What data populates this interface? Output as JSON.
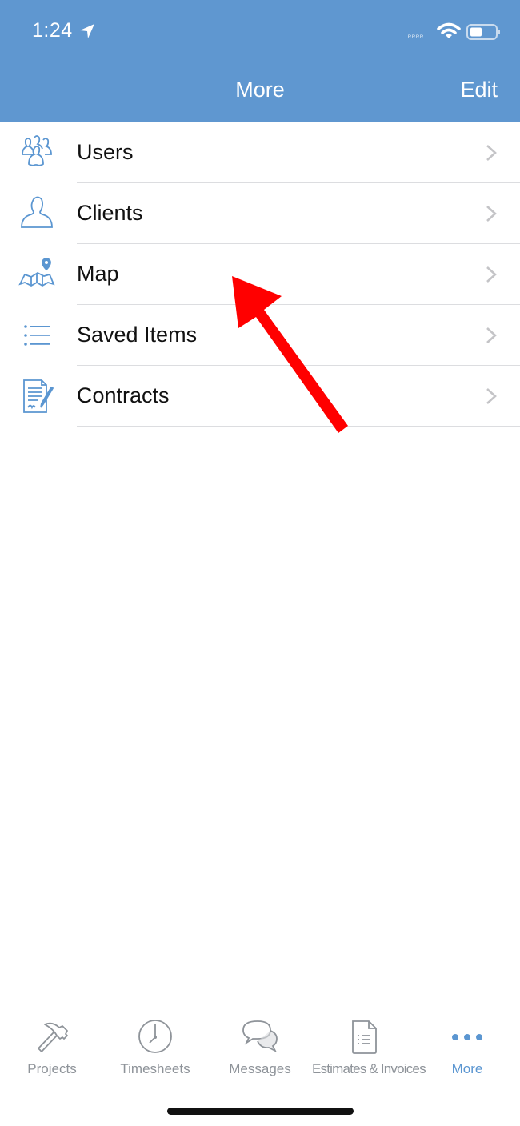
{
  "status_bar": {
    "time": "1:24",
    "signal_text": "ᴿᴿᴿᴿ",
    "icons": [
      "location-arrow-icon",
      "wifi-icon",
      "battery-icon"
    ]
  },
  "nav": {
    "title": "More",
    "edit_label": "Edit",
    "background_color": "#5f97d0"
  },
  "menu": {
    "items": [
      {
        "label": "Users",
        "icon": "users-icon"
      },
      {
        "label": "Clients",
        "icon": "client-icon"
      },
      {
        "label": "Map",
        "icon": "map-icon"
      },
      {
        "label": "Saved Items",
        "icon": "list-icon"
      },
      {
        "label": "Contracts",
        "icon": "contract-icon"
      }
    ]
  },
  "annotation": {
    "type": "red-arrow",
    "points_to": "Map",
    "color": "#ff0000"
  },
  "tabbar": {
    "tabs": [
      {
        "label": "Projects",
        "icon": "hammer-icon",
        "active": false
      },
      {
        "label": "Timesheets",
        "icon": "clock-icon",
        "active": false
      },
      {
        "label": "Messages",
        "icon": "chat-bubbles-icon",
        "active": false
      },
      {
        "label": "Estimates & Invoices",
        "icon": "document-icon",
        "active": false
      },
      {
        "label": "More",
        "icon": "more-dots-icon",
        "active": true
      }
    ],
    "active_color": "#5b96d1",
    "inactive_color": "#8e9399"
  }
}
